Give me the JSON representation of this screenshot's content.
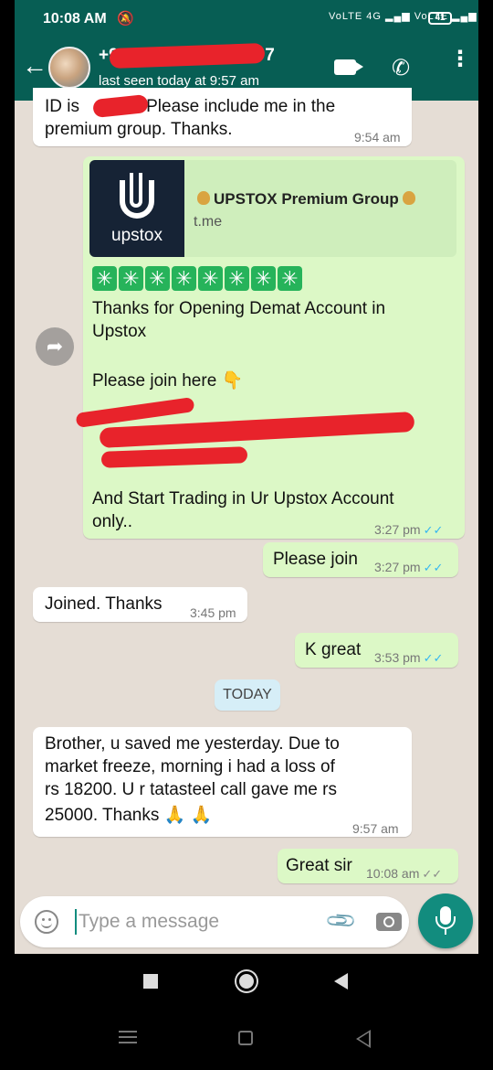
{
  "status_bar": {
    "time": "10:08 AM",
    "mute_icon": "bell-off-icon",
    "network": "VoLTE 4G ▂▄▆ VoLTE ▂▄▆",
    "battery": "41"
  },
  "header": {
    "back_icon": "arrow-left-icon",
    "contact_name": "+9",
    "contact_name_suffix": "7",
    "last_seen": "last seen today at 9:57 am",
    "video_icon": "video-call-icon",
    "phone_icon": "phone-icon",
    "menu_icon": "more-vert-icon"
  },
  "messages": {
    "m1": {
      "line1": "ID is",
      "line1_end": ". Please include me in the",
      "line2": "premium group. Thanks.",
      "time": "9:54 am"
    },
    "m2": {
      "preview_logo_text": "upstox",
      "preview_title": "UPSTOX Premium Group",
      "preview_url": "t.me",
      "stars": [
        "✳",
        "✳",
        "✳",
        "✳",
        "✳",
        "✳",
        "✳",
        "✳"
      ],
      "line1": "Thanks for Opening Demat Account in",
      "line2": "Upstox",
      "line3": "Please join here 👇",
      "line4": "And Start Trading in Ur Upstox Account",
      "line5": "only..",
      "time": "3:27 pm",
      "ticks": "✓✓"
    },
    "m3": {
      "text": "Please join",
      "time": "3:27 pm",
      "ticks": "✓✓"
    },
    "m4": {
      "text": "Joined. Thanks",
      "time": "3:45 pm"
    },
    "m5": {
      "text": "K great",
      "time": "3:53 pm",
      "ticks": "✓✓"
    },
    "day_chip": "TODAY",
    "m6": {
      "line1": "Brother, u saved me yesterday. Due to",
      "line2": "market freeze, morning i had a loss of",
      "line3": "rs 18200. U r tatasteel call gave me rs",
      "line4": "25000. Thanks 🙏 🙏",
      "time": "9:57 am"
    },
    "m7": {
      "text": "Great sir",
      "time": "10:08 am",
      "ticks": "✓✓"
    }
  },
  "input": {
    "placeholder": "Type a message",
    "emoji_icon": "emoji-icon",
    "attach_icon": "paperclip-icon",
    "camera_icon": "camera-icon",
    "mic_icon": "microphone-icon"
  },
  "colors": {
    "header": "#075e54",
    "outgoing_bubble": "#dcf8c6",
    "incoming_bubble": "#ffffff",
    "read_ticks": "#34b7f1",
    "mic_button": "#128c7e",
    "redaction": "#e8232b"
  }
}
